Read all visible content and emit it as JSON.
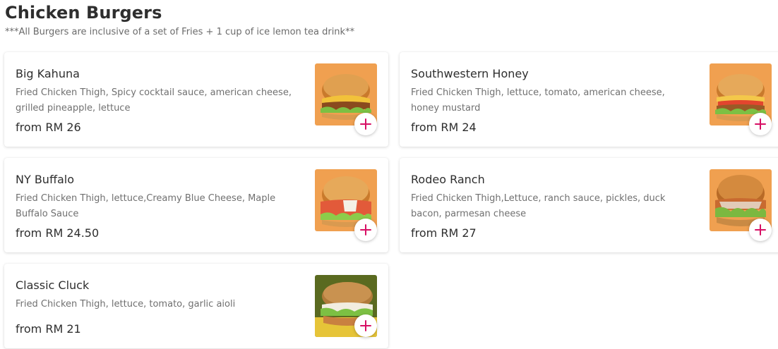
{
  "section": {
    "title": "Chicken Burgers",
    "note": "***All Burgers are inclusive of a set of Fries + 1 cup of ice lemon tea drink**"
  },
  "items": [
    {
      "name": "Big Kahuna",
      "description": "Fried Chicken Thigh, Spicy cocktail sauce, american cheese, grilled pineapple, lettuce",
      "price": "from RM 26"
    },
    {
      "name": "Southwestern Honey",
      "description": "Fried Chicken Thigh, lettuce, tomato, american cheese, honey mustard",
      "price": "from RM 24"
    },
    {
      "name": "NY Buffalo",
      "description": "Fried Chicken Thigh, lettuce,Creamy Blue Cheese, Maple Buffalo Sauce",
      "price": "from RM 24.50"
    },
    {
      "name": "Rodeo Ranch",
      "description": "Fried Chicken Thigh,Lettuce, ranch sauce, pickles, duck bacon, parmesan cheese",
      "price": "from RM 27"
    },
    {
      "name": "Classic Cluck",
      "description": "Fried Chicken Thigh, lettuce, tomato, garlic aioli",
      "price": "from RM 21"
    }
  ],
  "colors": {
    "accent": "#d70f64",
    "image_background_orange": "#f0a050",
    "image_background_green": "#5a6a20"
  },
  "icons": {
    "add": "plus-icon"
  }
}
